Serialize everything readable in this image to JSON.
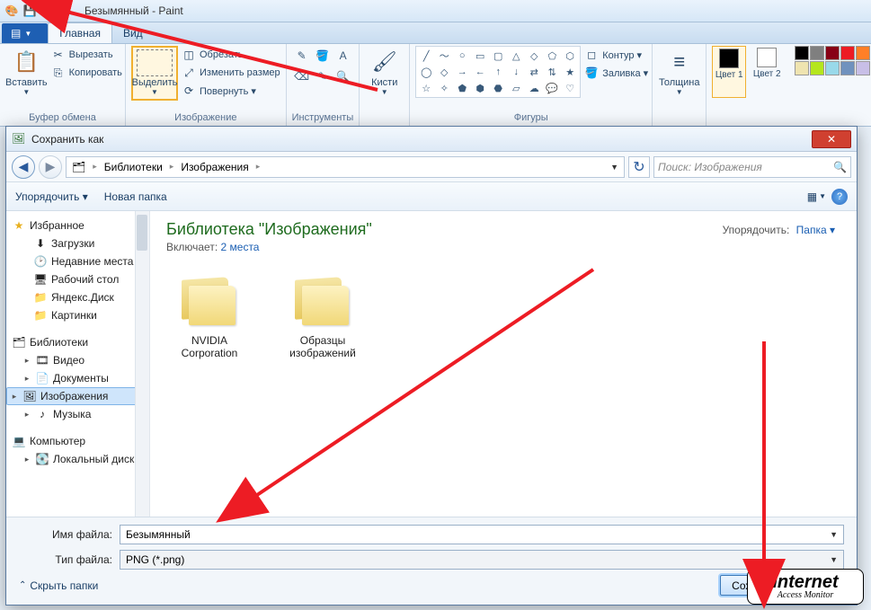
{
  "window": {
    "title": "Безымянный - Paint"
  },
  "tabs": {
    "home": "Главная",
    "view": "Вид"
  },
  "ribbon": {
    "clipboard": {
      "label": "Буфер обмена",
      "paste": "Вставить",
      "cut": "Вырезать",
      "copy": "Копировать"
    },
    "image": {
      "label": "Изображение",
      "select": "Выделить",
      "crop": "Обрезать",
      "resize": "Изменить размер",
      "rotate": "Повернуть ▾"
    },
    "tools": {
      "label": "Инструменты"
    },
    "brushes": {
      "label": "Кисти"
    },
    "shapes": {
      "label": "Фигуры",
      "outline": "Контур ▾",
      "fill": "Заливка ▾"
    },
    "thickness": {
      "label": "Толщина"
    },
    "colors": {
      "c1": "Цвет 1",
      "c2": "Цвет 2"
    }
  },
  "dialog": {
    "title": "Сохранить как",
    "crumb": [
      "Библиотеки",
      "Изображения"
    ],
    "search_placeholder": "Поиск: Изображения",
    "organize": "Упорядочить ▾",
    "newfolder": "Новая папка",
    "lib_title": "Библиотека \"Изображения\"",
    "lib_includes": "Включает:",
    "lib_places": "2 места",
    "sort_label": "Упорядочить:",
    "sort_value": "Папка ▾",
    "folders": [
      "NVIDIA Corporation",
      "Образцы изображений"
    ],
    "side": {
      "fav": "Избранное",
      "fav_items": [
        "Загрузки",
        "Недавние места",
        "Рабочий стол",
        "Яндекс.Диск",
        "Картинки"
      ],
      "lib": "Библиотеки",
      "lib_items": [
        "Видео",
        "Документы",
        "Изображения",
        "Музыка"
      ],
      "comp": "Компьютер",
      "comp_items": [
        "Локальный диск"
      ]
    },
    "filename_label": "Имя файла:",
    "filename_value": "Безымянный",
    "filetype_label": "Тип файла:",
    "filetype_value": "PNG (*.png)",
    "hide": "Скрыть папки",
    "save": "Сохранить"
  },
  "watermark": {
    "l1": "Internet",
    "l2": "Access Monitor"
  }
}
